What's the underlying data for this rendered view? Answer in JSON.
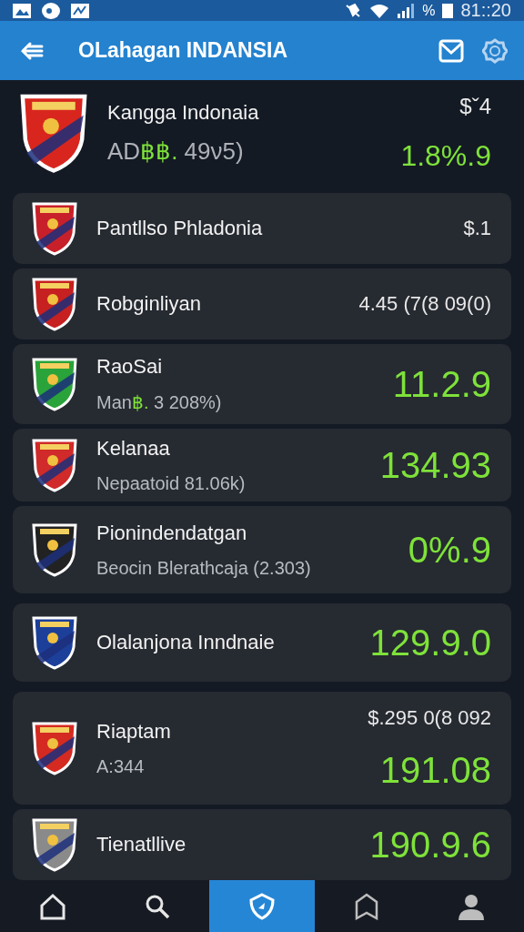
{
  "status_bar": {
    "battery_text": "%",
    "time": "81::20"
  },
  "app_bar": {
    "title": "OLahagan INDANSIA"
  },
  "rows": [
    {
      "kind": "featured",
      "name": "Kangga Indonaia",
      "subtitle": "AD",
      "subtitle_accent": "฿฿.",
      "subtitle_tail": "49ν5)",
      "price": "$ˇ4",
      "value": "1.8%.9",
      "positive": true,
      "color": "#d8261e"
    },
    {
      "kind": "card",
      "name": "Pantllso Phladonia",
      "price": "$.1",
      "color": "#c8202a"
    },
    {
      "kind": "card",
      "name": "Robginliyan",
      "price": "4.45 (7(8 09(0)",
      "color": "#c62020"
    },
    {
      "kind": "card",
      "name": "RaoSai",
      "subtitle": "Man",
      "subtitle_accent": "฿.",
      "subtitle_tail": "3 208%)",
      "value": "11.2.9",
      "positive": true,
      "color": "#2aa33a"
    },
    {
      "kind": "card",
      "name": "Kelanaa",
      "subtitle": "Nepaatoid 81.06k)",
      "value": "134.93",
      "positive": true,
      "color": "#d02a2a"
    },
    {
      "kind": "card",
      "name": "Pionindendatgan",
      "subtitle": "Beocin Blerathcaja (2.303)",
      "value": "0%.9",
      "positive": true,
      "color": "#222222"
    },
    {
      "kind": "card",
      "name": "Olalanjona Inndnaie",
      "value": "129.9.0",
      "positive": true,
      "color": "#1c3f9a"
    },
    {
      "kind": "card",
      "name": "Riaptam",
      "subtitle": "A:344",
      "price": "$.295 0(8 092",
      "value": "191.08",
      "positive": true,
      "color": "#d42a22"
    },
    {
      "kind": "card",
      "name": "Tienatllive",
      "value": "190.9.6",
      "positive": true,
      "color": "#8a8a8a"
    }
  ],
  "nav": [
    {
      "kind": "home",
      "selected": false
    },
    {
      "kind": "search",
      "selected": false
    },
    {
      "kind": "shield",
      "selected": true
    },
    {
      "kind": "tent",
      "selected": false
    },
    {
      "kind": "person",
      "selected": false
    }
  ]
}
